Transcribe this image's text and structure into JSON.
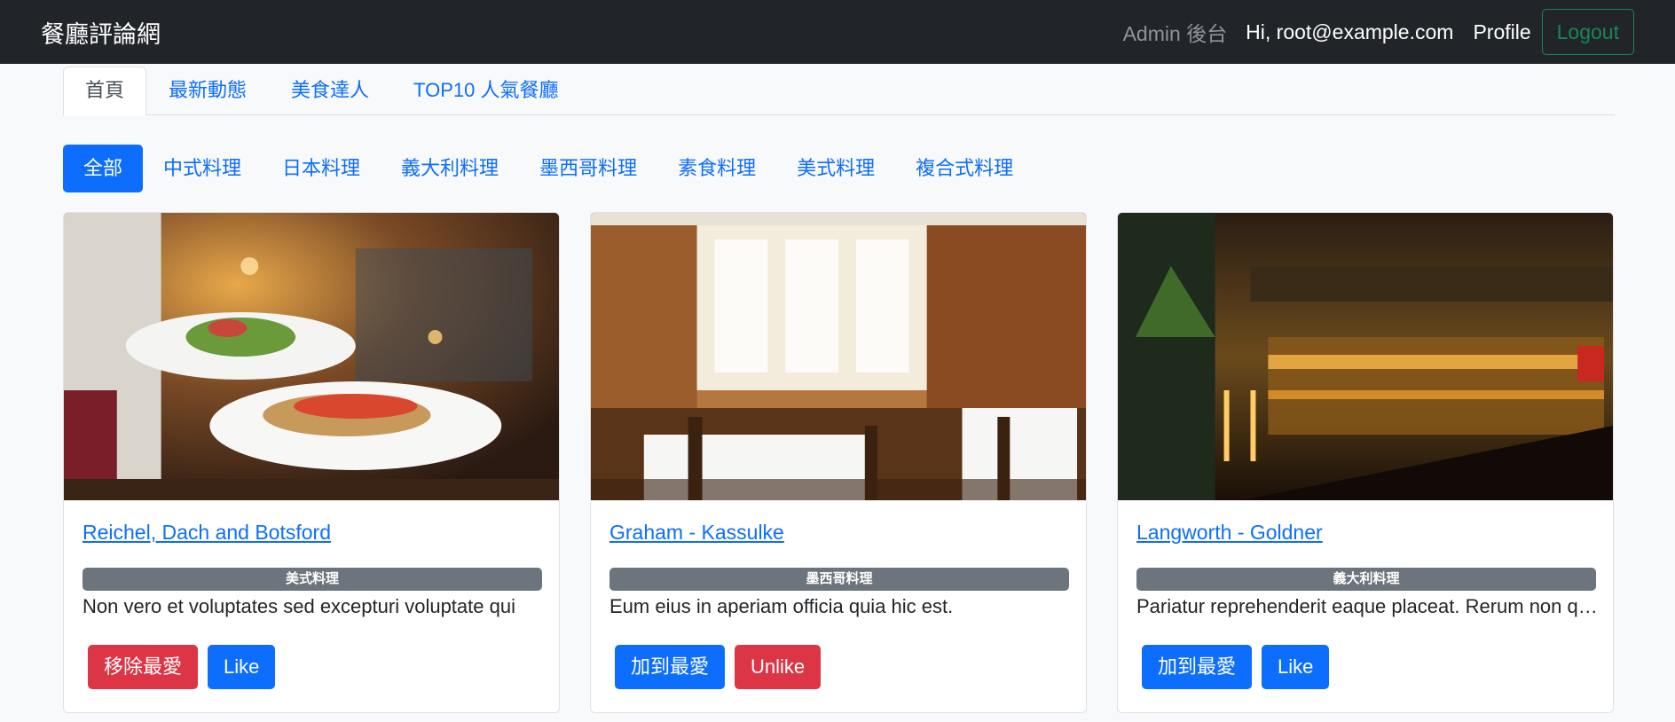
{
  "navbar": {
    "brand": "餐廳評論網",
    "admin": "Admin 後台",
    "user": "Hi, root@example.com",
    "profile": "Profile",
    "logout": "Logout"
  },
  "tabs": [
    "首頁",
    "最新動態",
    "美食達人",
    "TOP10 人氣餐廳"
  ],
  "categories": [
    "全部",
    "中式料理",
    "日本料理",
    "義大利料理",
    "墨西哥料理",
    "素食料理",
    "美式料理",
    "複合式料理"
  ],
  "restaurants": [
    {
      "name": "Reichel, Dach and Botsford",
      "category": "美式料理",
      "description": "Non vero et voluptates sed excepturi voluptate qui",
      "favorite_label": "移除最愛",
      "like_label": "Like"
    },
    {
      "name": "Graham - Kassulke",
      "category": "墨西哥料理",
      "description": "Eum eius in aperiam officia quia hic est.",
      "favorite_label": "加到最愛",
      "like_label": "Unlike"
    },
    {
      "name": "Langworth - Goldner",
      "category": "義大利料理",
      "description": "Pariatur reprehenderit eaque placeat. Rerum non quia",
      "favorite_label": "加到最愛",
      "like_label": "Like"
    }
  ],
  "colors": {
    "navbar": "#212529",
    "primary": "#0d6efd",
    "danger": "#dc3545",
    "success": "#198754",
    "badge": "#6c757d"
  }
}
